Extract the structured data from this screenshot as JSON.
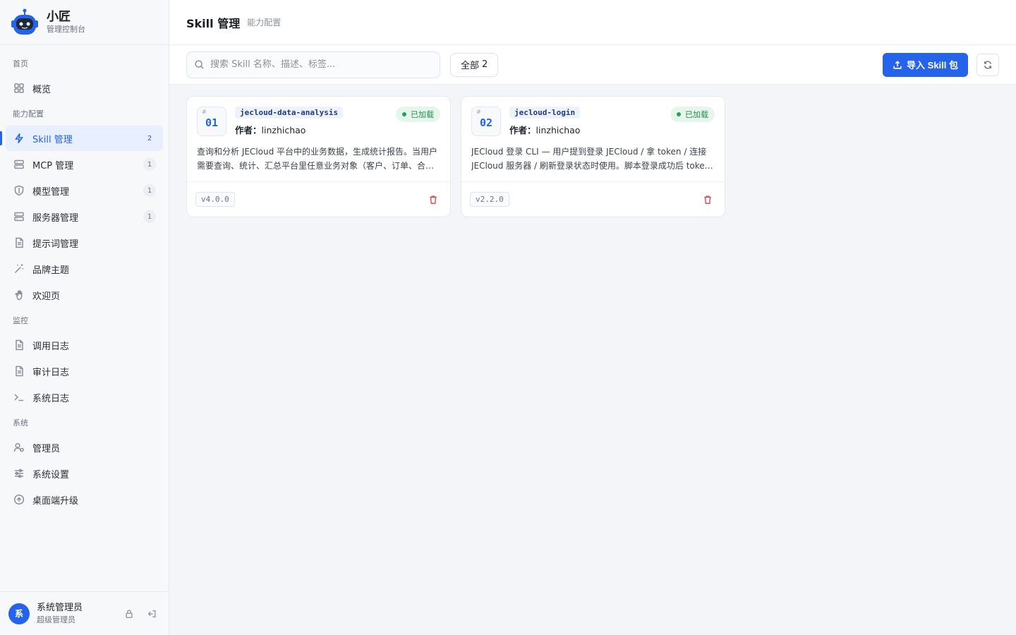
{
  "brand": {
    "name": "小匠",
    "subtitle": "管理控制台",
    "logo_icon": "robot-logo-icon"
  },
  "nav": {
    "groups": [
      {
        "label": "首页",
        "items": [
          {
            "label": "概览",
            "icon": "grid-icon",
            "badge": ""
          }
        ]
      },
      {
        "label": "能力配置",
        "items": [
          {
            "label": "Skill 管理",
            "icon": "lightning-icon",
            "badge": "2",
            "active": true
          },
          {
            "label": "MCP 管理",
            "icon": "server-icon",
            "badge": "1"
          },
          {
            "label": "模型管理",
            "icon": "shield-icon",
            "badge": "1"
          },
          {
            "label": "服务器管理",
            "icon": "server-icon",
            "badge": "1"
          },
          {
            "label": "提示词管理",
            "icon": "document-icon",
            "badge": ""
          },
          {
            "label": "品牌主题",
            "icon": "magic-wand-icon",
            "badge": ""
          },
          {
            "label": "欢迎页",
            "icon": "wave-hand-icon",
            "badge": ""
          }
        ]
      },
      {
        "label": "监控",
        "items": [
          {
            "label": "调用日志",
            "icon": "document-icon",
            "badge": ""
          },
          {
            "label": "审计日志",
            "icon": "document-icon",
            "badge": ""
          },
          {
            "label": "系统日志",
            "icon": "terminal-icon",
            "badge": ""
          }
        ]
      },
      {
        "label": "系统",
        "items": [
          {
            "label": "管理员",
            "icon": "users-icon",
            "badge": ""
          },
          {
            "label": "系统设置",
            "icon": "sliders-icon",
            "badge": ""
          },
          {
            "label": "桌面端升级",
            "icon": "upgrade-icon",
            "badge": ""
          }
        ]
      }
    ]
  },
  "user": {
    "avatar_text": "系",
    "name": "系统管理员",
    "role": "超级管理员"
  },
  "header": {
    "title": "Skill 管理",
    "subtitle": "能力配置"
  },
  "toolbar": {
    "search_placeholder": "搜索 Skill 名称、描述、标签...",
    "search_value": "",
    "filter_label": "全部",
    "filter_count": "2",
    "import_label": "导入 Skill 包"
  },
  "cards": [
    {
      "num": "01",
      "hash": "#",
      "name": "jecloud-data-analysis",
      "author_label": "作者：",
      "author": "linzhichao",
      "status": "已加载",
      "description": "查询和分析 JECloud 平台中的业务数据，生成统计报告。当用户需要查询、统计、汇总平台里任意业务对象（客户、订单、合同等）时使用。",
      "version": "v4.0.0"
    },
    {
      "num": "02",
      "hash": "#",
      "name": "jecloud-login",
      "author_label": "作者：",
      "author": "linzhichao",
      "status": "已加载",
      "description": "JECloud 登录 CLI — 用户提到登录 JECloud / 拿 token / 连接 JECloud 服务器 / 刷新登录状态时使用。脚本登录成功后 token 会被保存。",
      "version": "v2.2.0"
    }
  ],
  "colors": {
    "accent": "#2563eb",
    "success": "#22a35a",
    "danger": "#e5484d"
  }
}
